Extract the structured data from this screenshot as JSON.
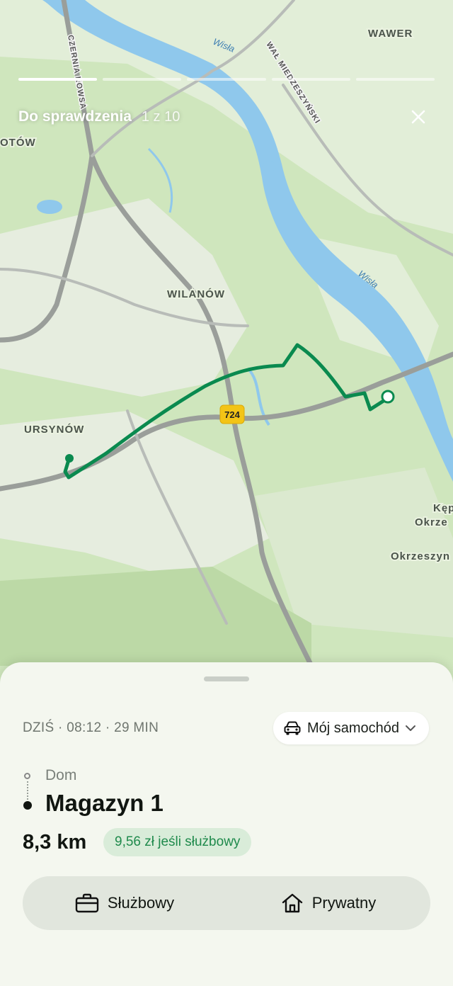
{
  "story": {
    "segments": 10,
    "active_index": 0
  },
  "header": {
    "title": "Do sprawdzenia",
    "counter": "1 z 10"
  },
  "map": {
    "districts": [
      "WAWER",
      "WILANÓW",
      "URSYNÓW",
      "OTÓW",
      "Kęp",
      "Okrze",
      "Okrzeszyn"
    ],
    "roads": [
      "CZERNIA KOWSA",
      "WAŁ MIEDZESZYŃSKI"
    ],
    "rivers": [
      "Wisła",
      "Wisła"
    ],
    "road_badge": "724",
    "colors": {
      "land": "#cfe6bd",
      "water": "#8fc8ec",
      "route": "#0a8a4f",
      "road_badge": "#f3c416"
    }
  },
  "trip": {
    "meta": "DZIŚ · 08:12 · 29 MIN",
    "vehicle": "Mój samochód",
    "from": "Dom",
    "to": "Magazyn 1",
    "distance": "8,3 km",
    "reimbursement": "9,56 zł jeśli służbowy"
  },
  "actions": {
    "business": "Służbowy",
    "private": "Prywatny"
  },
  "icons": {
    "close": "close-icon",
    "car": "car-icon",
    "chevron": "chevron-down-icon",
    "briefcase": "briefcase-icon",
    "home": "home-icon"
  }
}
